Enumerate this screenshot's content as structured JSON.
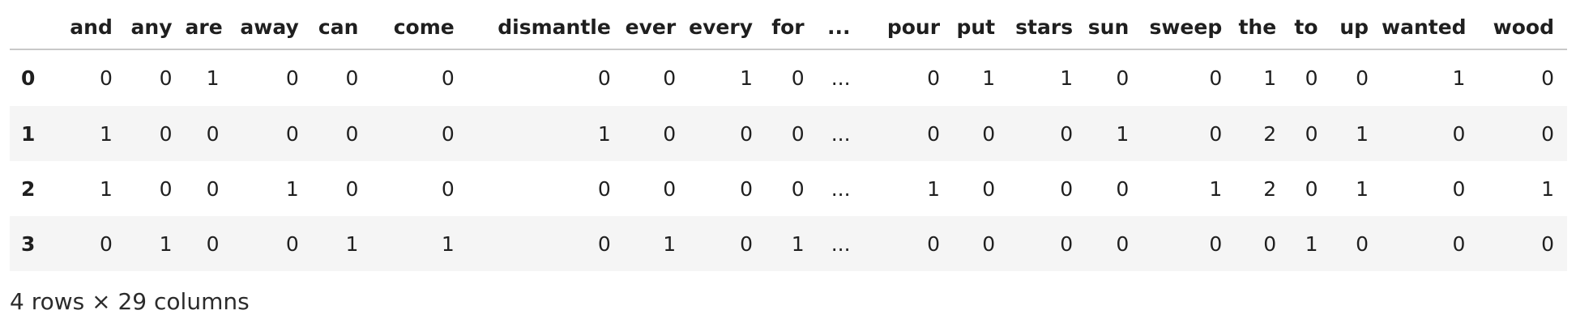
{
  "table": {
    "columns": [
      "",
      "and",
      "any",
      "are",
      "away",
      "can",
      "come",
      "dismantle",
      "ever",
      "every",
      "for",
      "...",
      "pour",
      "put",
      "stars",
      "sun",
      "sweep",
      "the",
      "to",
      "up",
      "wanted",
      "wood"
    ],
    "rows": [
      [
        "0",
        "0",
        "0",
        "1",
        "0",
        "0",
        "0",
        "0",
        "0",
        "1",
        "0",
        "...",
        "0",
        "1",
        "1",
        "0",
        "0",
        "1",
        "0",
        "0",
        "1",
        "0"
      ],
      [
        "1",
        "1",
        "0",
        "0",
        "0",
        "0",
        "0",
        "1",
        "0",
        "0",
        "0",
        "...",
        "0",
        "0",
        "0",
        "1",
        "0",
        "2",
        "0",
        "1",
        "0",
        "0"
      ],
      [
        "2",
        "1",
        "0",
        "0",
        "1",
        "0",
        "0",
        "0",
        "0",
        "0",
        "0",
        "...",
        "1",
        "0",
        "0",
        "0",
        "1",
        "2",
        "0",
        "1",
        "0",
        "1"
      ],
      [
        "3",
        "0",
        "1",
        "0",
        "0",
        "1",
        "1",
        "0",
        "1",
        "0",
        "1",
        "...",
        "0",
        "0",
        "0",
        "0",
        "0",
        "0",
        "1",
        "0",
        "0",
        "0"
      ]
    ]
  },
  "footer": "4 rows × 29 columns"
}
